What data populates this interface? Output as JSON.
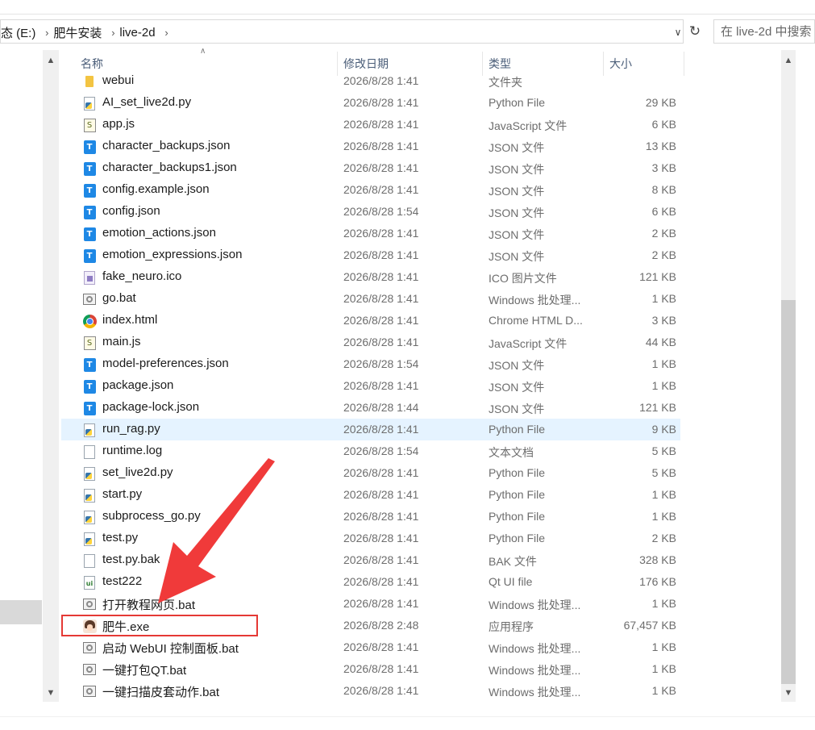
{
  "breadcrumb": [
    "态 (E:)",
    "肥牛安装",
    "live-2d"
  ],
  "search": {
    "placeholder": "在 live-2d 中搜索"
  },
  "columns": {
    "name": "名称",
    "date": "修改日期",
    "type": "类型",
    "size": "大小"
  },
  "files": [
    {
      "name": "webui",
      "date": "2026/8/28 1:41",
      "type": "文件夹",
      "size": "",
      "icon": "folder-icon"
    },
    {
      "name": "AI_set_live2d.py",
      "date": "2026/8/28 1:41",
      "type": "Python File",
      "size": "29 KB",
      "icon": "python-file-icon"
    },
    {
      "name": "app.js",
      "date": "2026/8/28 1:41",
      "type": "JavaScript 文件",
      "size": "6 KB",
      "icon": "javascript-file-icon"
    },
    {
      "name": "character_backups.json",
      "date": "2026/8/28 1:41",
      "type": "JSON 文件",
      "size": "13 KB",
      "icon": "json-file-icon"
    },
    {
      "name": "character_backups1.json",
      "date": "2026/8/28 1:41",
      "type": "JSON 文件",
      "size": "3 KB",
      "icon": "json-file-icon"
    },
    {
      "name": "config.example.json",
      "date": "2026/8/28 1:41",
      "type": "JSON 文件",
      "size": "8 KB",
      "icon": "json-file-icon"
    },
    {
      "name": "config.json",
      "date": "2026/8/28 1:54",
      "type": "JSON 文件",
      "size": "6 KB",
      "icon": "json-file-icon"
    },
    {
      "name": "emotion_actions.json",
      "date": "2026/8/28 1:41",
      "type": "JSON 文件",
      "size": "2 KB",
      "icon": "json-file-icon"
    },
    {
      "name": "emotion_expressions.json",
      "date": "2026/8/28 1:41",
      "type": "JSON 文件",
      "size": "2 KB",
      "icon": "json-file-icon"
    },
    {
      "name": "fake_neuro.ico",
      "date": "2026/8/28 1:41",
      "type": "ICO 图片文件",
      "size": "121 KB",
      "icon": "ico-file-icon"
    },
    {
      "name": "go.bat",
      "date": "2026/8/28 1:41",
      "type": "Windows 批处理...",
      "size": "1 KB",
      "icon": "batch-file-icon"
    },
    {
      "name": "index.html",
      "date": "2026/8/28 1:41",
      "type": "Chrome HTML D...",
      "size": "3 KB",
      "icon": "chrome-html-icon"
    },
    {
      "name": "main.js",
      "date": "2026/8/28 1:41",
      "type": "JavaScript 文件",
      "size": "44 KB",
      "icon": "javascript-file-icon"
    },
    {
      "name": "model-preferences.json",
      "date": "2026/8/28 1:54",
      "type": "JSON 文件",
      "size": "1 KB",
      "icon": "json-file-icon"
    },
    {
      "name": "package.json",
      "date": "2026/8/28 1:41",
      "type": "JSON 文件",
      "size": "1 KB",
      "icon": "json-file-icon"
    },
    {
      "name": "package-lock.json",
      "date": "2026/8/28 1:44",
      "type": "JSON 文件",
      "size": "121 KB",
      "icon": "json-file-icon"
    },
    {
      "name": "run_rag.py",
      "date": "2026/8/28 1:41",
      "type": "Python File",
      "size": "9 KB",
      "icon": "python-file-icon",
      "state": "hover"
    },
    {
      "name": "runtime.log",
      "date": "2026/8/28 1:54",
      "type": "文本文档",
      "size": "5 KB",
      "icon": "text-file-icon"
    },
    {
      "name": "set_live2d.py",
      "date": "2026/8/28 1:41",
      "type": "Python File",
      "size": "5 KB",
      "icon": "python-file-icon"
    },
    {
      "name": "start.py",
      "date": "2026/8/28 1:41",
      "type": "Python File",
      "size": "1 KB",
      "icon": "python-file-icon"
    },
    {
      "name": "subprocess_go.py",
      "date": "2026/8/28 1:41",
      "type": "Python File",
      "size": "1 KB",
      "icon": "python-file-icon"
    },
    {
      "name": "test.py",
      "date": "2026/8/28 1:41",
      "type": "Python File",
      "size": "2 KB",
      "icon": "python-file-icon"
    },
    {
      "name": "test.py.bak",
      "date": "2026/8/28 1:41",
      "type": "BAK 文件",
      "size": "328 KB",
      "icon": "blank-file-icon"
    },
    {
      "name": "test222",
      "date": "2026/8/28 1:41",
      "type": "Qt UI file",
      "size": "176 KB",
      "icon": "qt-ui-file-icon"
    },
    {
      "name": "打开教程网页.bat",
      "date": "2026/8/28 1:41",
      "type": "Windows 批处理...",
      "size": "1 KB",
      "icon": "batch-file-icon"
    },
    {
      "name": "肥牛.exe",
      "date": "2026/8/28 2:48",
      "type": "应用程序",
      "size": "67,457 KB",
      "icon": "application-icon",
      "state": "highlighted"
    },
    {
      "name": "启动 WebUI 控制面板.bat",
      "date": "2026/8/28 1:41",
      "type": "Windows 批处理...",
      "size": "1 KB",
      "icon": "batch-file-icon"
    },
    {
      "name": "一键打包QT.bat",
      "date": "2026/8/28 1:41",
      "type": "Windows 批处理...",
      "size": "1 KB",
      "icon": "batch-file-icon"
    },
    {
      "name": "一键扫描皮套动作.bat",
      "date": "2026/8/28 1:41",
      "type": "Windows 批处理...",
      "size": "1 KB",
      "icon": "batch-file-icon"
    }
  ],
  "colors": {
    "highlight_box": "#e53935",
    "annotation_arrow": "#f03a3a",
    "hover_row": "#e5f3ff",
    "header_text": "#4a5d78"
  }
}
